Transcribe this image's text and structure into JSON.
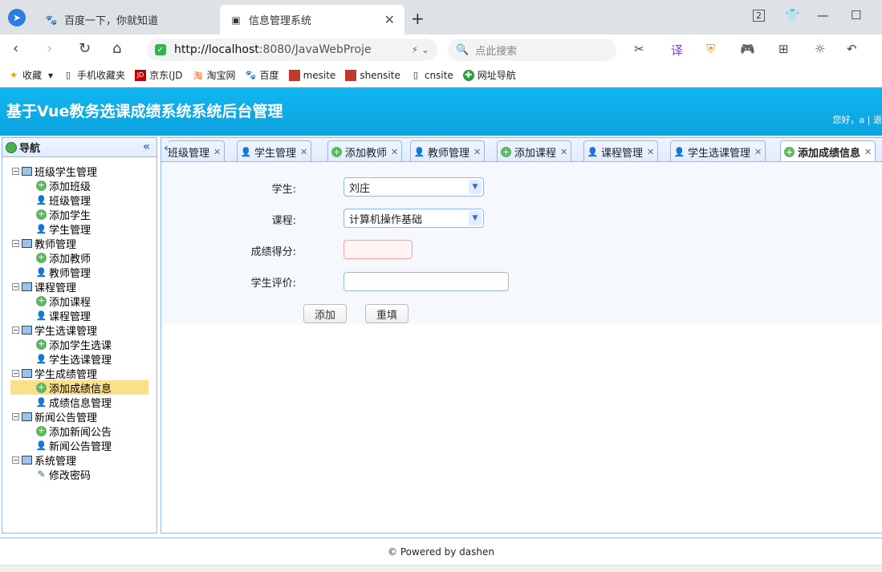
{
  "browser": {
    "tabs": [
      {
        "title": "百度一下，你就知道",
        "icon": "paw-icon"
      },
      {
        "title": "信息管理系统",
        "icon": "page-icon"
      }
    ],
    "url_host": "http://localhost",
    "url_rest": ":8080/JavaWebProje",
    "search_placeholder": "点此搜索",
    "bookmarks": [
      {
        "label": "收藏",
        "icon": "star-icon"
      },
      {
        "label": "手机收藏夹",
        "icon": "phone-icon"
      },
      {
        "label": "京东(JD",
        "icon": "jd-icon"
      },
      {
        "label": "淘宝网",
        "icon": "taobao-icon"
      },
      {
        "label": "百度",
        "icon": "paw-icon"
      },
      {
        "label": "mesite",
        "icon": "site-icon"
      },
      {
        "label": "shensite",
        "icon": "site-icon"
      },
      {
        "label": "cnsite",
        "icon": "page-icon"
      },
      {
        "label": "网址导航",
        "icon": "compass-icon"
      }
    ],
    "tab_counter": "2"
  },
  "header": {
    "title": "基于Vue教务选课成绩系统系统后台管理",
    "greeting": "您好，a | 退"
  },
  "sidebar": {
    "title": "导航",
    "groups": [
      {
        "label": "班级学生管理",
        "items": [
          {
            "label": "添加班级",
            "type": "add"
          },
          {
            "label": "班级管理",
            "type": "user"
          },
          {
            "label": "添加学生",
            "type": "add"
          },
          {
            "label": "学生管理",
            "type": "user"
          }
        ]
      },
      {
        "label": "教师管理",
        "items": [
          {
            "label": "添加教师",
            "type": "add"
          },
          {
            "label": "教师管理",
            "type": "user"
          }
        ]
      },
      {
        "label": "课程管理",
        "items": [
          {
            "label": "添加课程",
            "type": "add"
          },
          {
            "label": "课程管理",
            "type": "user"
          }
        ]
      },
      {
        "label": "学生选课管理",
        "items": [
          {
            "label": "添加学生选课",
            "type": "add"
          },
          {
            "label": "学生选课管理",
            "type": "user"
          }
        ]
      },
      {
        "label": "学生成绩管理",
        "items": [
          {
            "label": "添加成绩信息",
            "type": "add",
            "selected": true
          },
          {
            "label": "成绩信息管理",
            "type": "user"
          }
        ]
      },
      {
        "label": "新闻公告管理",
        "items": [
          {
            "label": "添加新闻公告",
            "type": "add"
          },
          {
            "label": "新闻公告管理",
            "type": "user"
          }
        ]
      },
      {
        "label": "系统管理",
        "items": [
          {
            "label": "修改密码",
            "type": "pen"
          }
        ]
      }
    ]
  },
  "tabs": [
    {
      "label": "班级管理",
      "icon": "user"
    },
    {
      "label": "学生管理",
      "icon": "user"
    },
    {
      "label": "添加教师",
      "icon": "add"
    },
    {
      "label": "教师管理",
      "icon": "user"
    },
    {
      "label": "添加课程",
      "icon": "add"
    },
    {
      "label": "课程管理",
      "icon": "user"
    },
    {
      "label": "学生选课管理",
      "icon": "user"
    },
    {
      "label": "添加成绩信息",
      "icon": "add",
      "active": true
    }
  ],
  "form": {
    "student_label": "学生:",
    "student_value": "刘庄",
    "course_label": "课程:",
    "course_value": "计算机操作基础",
    "score_label": "成绩得分:",
    "score_value": "",
    "comment_label": "学生评价:",
    "comment_value": "",
    "add_button": "添加",
    "reset_button": "重填"
  },
  "footer": {
    "text": "© Powered by dashen"
  }
}
